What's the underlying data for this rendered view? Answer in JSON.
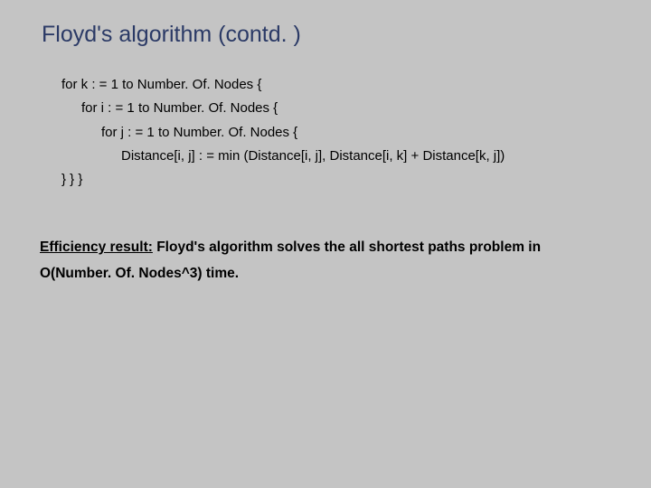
{
  "title": "Floyd's algorithm (contd. )",
  "code": {
    "l1": "for k : = 1 to Number. Of. Nodes {",
    "l2": "for i : = 1 to Number. Of. Nodes {",
    "l3": "for j : = 1 to Number. Of. Nodes {",
    "l4": "Distance[i, j] : = min (Distance[i, j], Distance[i, k] + Distance[k, j])",
    "close": "} } }"
  },
  "efficiency": {
    "label": "Efficiency result:",
    "rest1": " Floyd's algorithm solves the all shortest paths problem in",
    "line2": "O(Number. Of. Nodes^3) time."
  }
}
